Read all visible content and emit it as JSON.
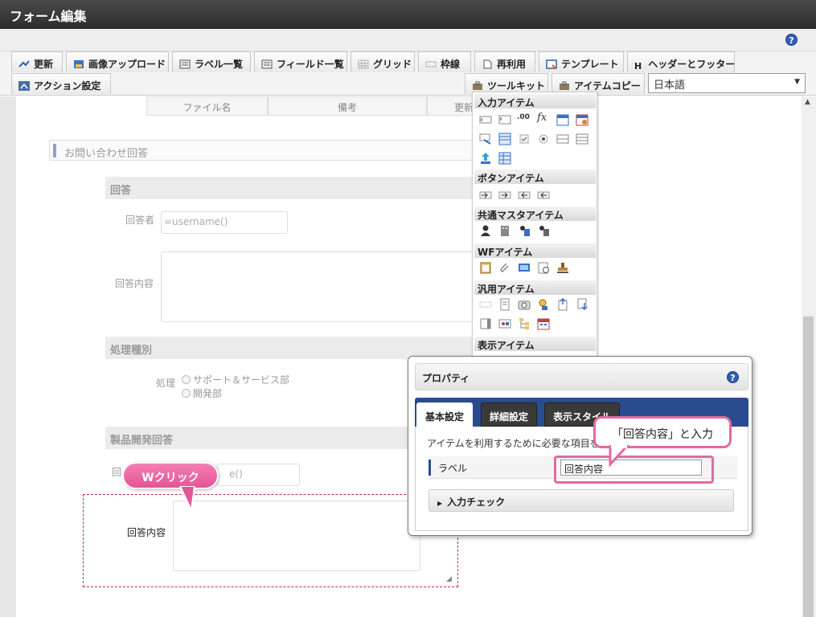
{
  "window": {
    "title": "フォーム編集",
    "help_icon": "?"
  },
  "toolbar": {
    "row1": [
      {
        "label": "更新",
        "icon": "update-icon"
      },
      {
        "label": "画像アップロード",
        "icon": "image-upload-icon"
      },
      {
        "label": "ラベル一覧",
        "icon": "label-list-icon"
      },
      {
        "label": "フィールド一覧",
        "icon": "field-list-icon"
      },
      {
        "label": "グリッド",
        "icon": "grid-icon"
      },
      {
        "label": "枠線",
        "icon": "border-icon"
      },
      {
        "label": "再利用",
        "icon": "reuse-icon"
      },
      {
        "label": "テンプレート",
        "icon": "template-icon"
      },
      {
        "label": "ヘッダーとフッター",
        "icon": "header-footer-icon",
        "glyph": "H"
      }
    ],
    "row2_left": {
      "label": "アクション設定",
      "icon": "action-settings-icon"
    },
    "toolkit": {
      "label": "ツールキット",
      "icon": "toolkit-icon"
    },
    "item_copy": {
      "label": "アイテムコピー",
      "icon": "item-copy-icon"
    },
    "language": {
      "value": "日本語",
      "arrow": "▼"
    }
  },
  "table_header": {
    "col1": "ファイル名",
    "col2": "備考",
    "col3": "更新"
  },
  "form": {
    "section_title": "お問い合わせ回答",
    "group1": {
      "title": "回答",
      "responder_label": "回答者",
      "responder_value": "=username()",
      "content_label": "回答内容"
    },
    "group2": {
      "title": "処理種別",
      "label": "処理",
      "options": [
        "サポート＆サービス部",
        "開発部"
      ]
    },
    "group3": {
      "title": "製品開発回答",
      "responder_label_partial": "回",
      "responder_value_partial": "e()",
      "content_label": "回答内容"
    }
  },
  "palette": {
    "categories": [
      "入力アイテム",
      "ボタンアイテム",
      "共通マスタアイテム",
      "WFアイテム",
      "汎用アイテム",
      "表示アイテム"
    ],
    "input_items_text": [
      ".00",
      "fx"
    ]
  },
  "properties": {
    "title": "プロパティ",
    "help": "?",
    "tabs": [
      "基本設定",
      "詳細設定",
      "表示スタイル"
    ],
    "description": "アイテムを利用するために必要な項目を設",
    "label_field": {
      "label": "ラベル",
      "value": "回答内容"
    },
    "input_check": "入力チェック",
    "input_check_arrow": "▶"
  },
  "annotations": {
    "double_click": "Wクリック",
    "enter_text": "「回答内容」と入力"
  },
  "colors": {
    "titlebar": "#333333",
    "tab_bar": "#2a4c8f",
    "callout_pink": "#e26aa0",
    "selection_dashed": "#c0304a"
  }
}
